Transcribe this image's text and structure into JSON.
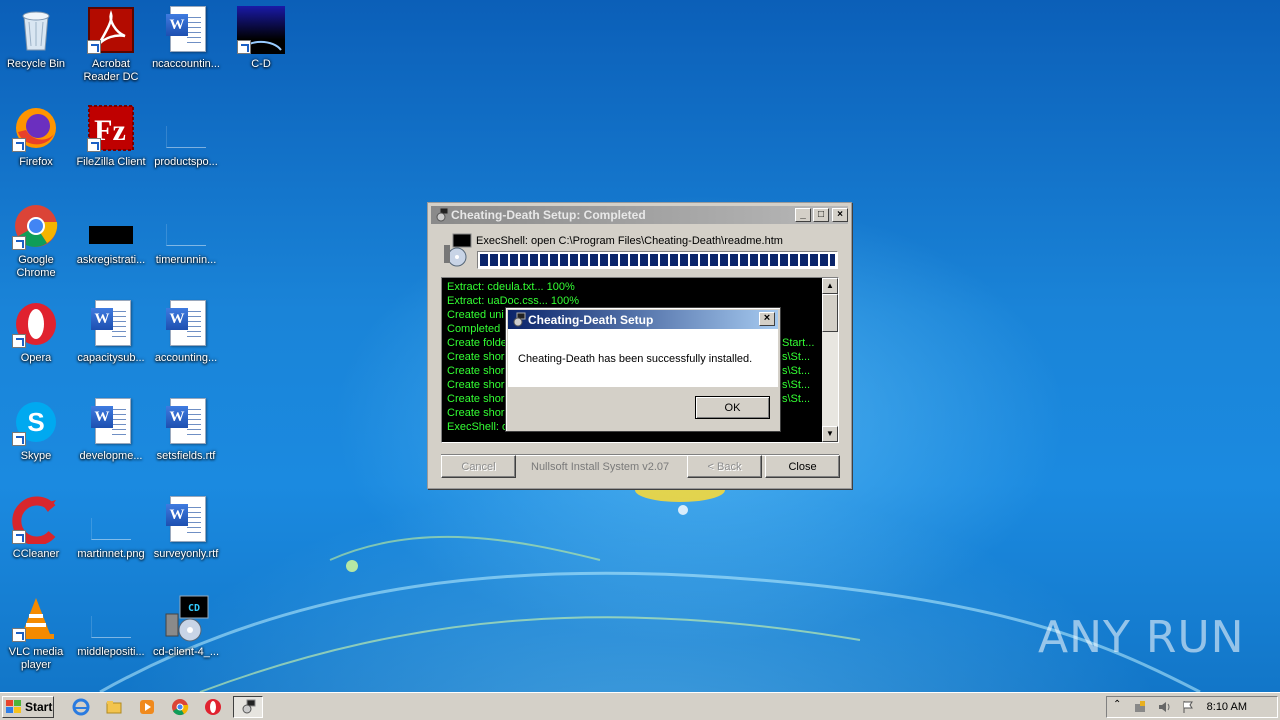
{
  "desktop": {
    "icons": [
      {
        "label": "Recycle Bin"
      },
      {
        "label": "Acrobat Reader DC"
      },
      {
        "label": "ncaccountin..."
      },
      {
        "label": "C-D"
      },
      {
        "label": "Firefox"
      },
      {
        "label": "FileZilla Client"
      },
      {
        "label": "productspo..."
      },
      {
        "label": "Google Chrome"
      },
      {
        "label": "askregistrati..."
      },
      {
        "label": "timerunnin..."
      },
      {
        "label": "Opera"
      },
      {
        "label": "capacitysub..."
      },
      {
        "label": "accounting..."
      },
      {
        "label": "Skype"
      },
      {
        "label": "developme..."
      },
      {
        "label": "setsfields.rtf"
      },
      {
        "label": "CCleaner"
      },
      {
        "label": "martinnet.png"
      },
      {
        "label": "surveyonly.rtf"
      },
      {
        "label": "VLC media player"
      },
      {
        "label": "middlepositi..."
      },
      {
        "label": "cd-client-4_..."
      }
    ]
  },
  "installer": {
    "title": "Cheating-Death Setup: Completed",
    "status": "ExecShell: open C:\\Program Files\\Cheating-Death\\readme.htm",
    "progress_fraction": 1.0,
    "log": [
      "Extract: cdeula.txt... 100%",
      "Extract: uaDoc.css... 100%",
      "Created uni",
      "Completed",
      "Create folde",
      "Create shor",
      "Create shor",
      "Create shor",
      "Create shor",
      "Create shor",
      "ExecShell: o"
    ],
    "log_tails": [
      "Start...",
      "s\\St...",
      "s\\St...",
      "s\\St...",
      "s\\St..."
    ],
    "buttons": {
      "cancel": "Cancel",
      "back": "< Back",
      "close": "Close"
    },
    "branding": "Nullsoft Install System v2.07"
  },
  "dialog": {
    "title": "Cheating-Death Setup",
    "message": "Cheating-Death has been successfully installed.",
    "ok": "OK",
    "close_glyph": "×"
  },
  "taskbar": {
    "start": "Start",
    "clock": "8:10 AM"
  },
  "watermark": "ANY RUN",
  "colors": {
    "log_text": "#33ff33",
    "progress": "#0a246a",
    "dialog_title": "#0a246a"
  }
}
